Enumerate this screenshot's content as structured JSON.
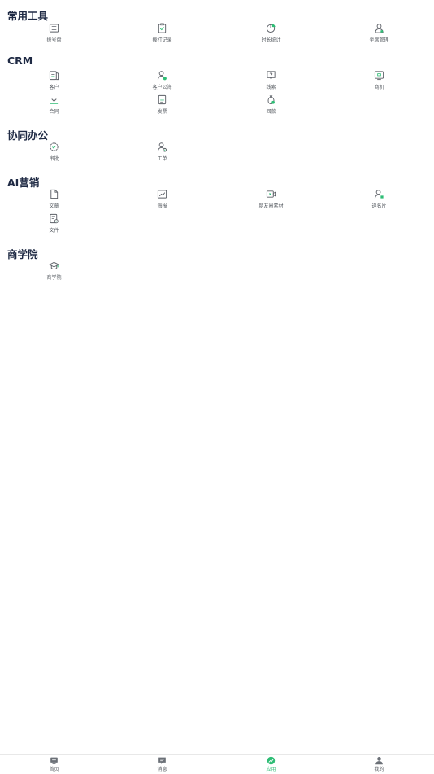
{
  "sections": {
    "common": {
      "title": "常用工具",
      "items": [
        "拨号盘",
        "拨打记录",
        "时长统计",
        "坐席管理"
      ]
    },
    "crm": {
      "title": "CRM",
      "items": [
        "客户",
        "客户公海",
        "线索",
        "商机",
        "合同",
        "发票",
        "回款"
      ]
    },
    "office": {
      "title": "协同办公",
      "items": [
        "审批",
        "工单"
      ]
    },
    "marketing": {
      "title": "AI营销",
      "items": [
        "文章",
        "海报",
        "朋友圈素材",
        "递名片",
        "文件"
      ]
    },
    "academy": {
      "title": "商学院",
      "items": [
        "商学院"
      ]
    }
  },
  "tabbar": {
    "items": [
      "首页",
      "消息",
      "应用",
      "我的"
    ],
    "active": "应用"
  },
  "colors": {
    "accent": "#2ebd75",
    "icon": "#5b5f66",
    "title": "#1f2a44"
  }
}
